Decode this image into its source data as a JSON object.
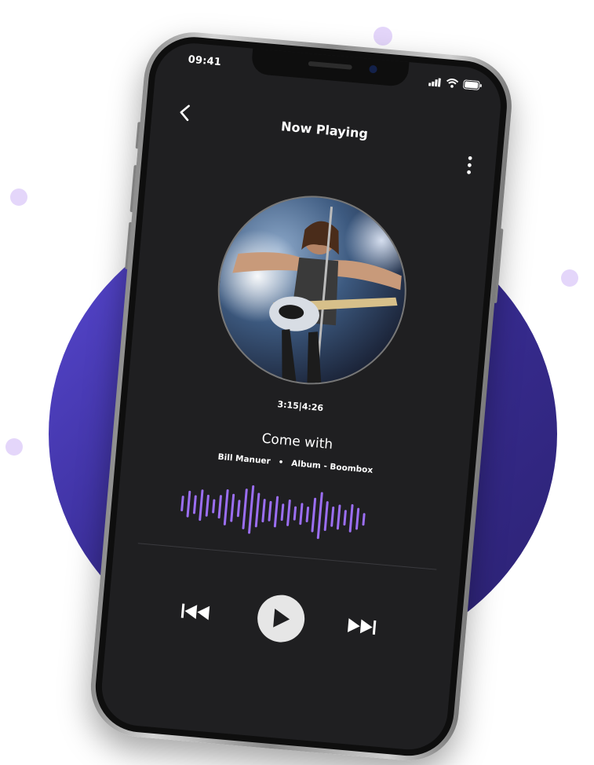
{
  "status_bar": {
    "time": "09:41"
  },
  "header": {
    "title": "Now Playing"
  },
  "player": {
    "elapsed": "3:15",
    "separator": "|",
    "duration": "4:26",
    "track_title": "Come with",
    "artist": "Bill Manuer",
    "meta_separator": "•",
    "album": "Album - Boombox",
    "waveform_color": "#9b6ef3"
  },
  "icons": {
    "back": "back-arrow-icon",
    "menu": "more-vertical-icon",
    "previous": "previous-track-icon",
    "play": "play-icon",
    "next": "next-track-icon",
    "signal": "signal-icon",
    "wifi": "wifi-icon",
    "battery": "battery-icon"
  },
  "colors": {
    "background": "#ffffff",
    "blob": "#4a3cc0",
    "screen": "#1f1f21",
    "accent": "#9b6ef3"
  }
}
